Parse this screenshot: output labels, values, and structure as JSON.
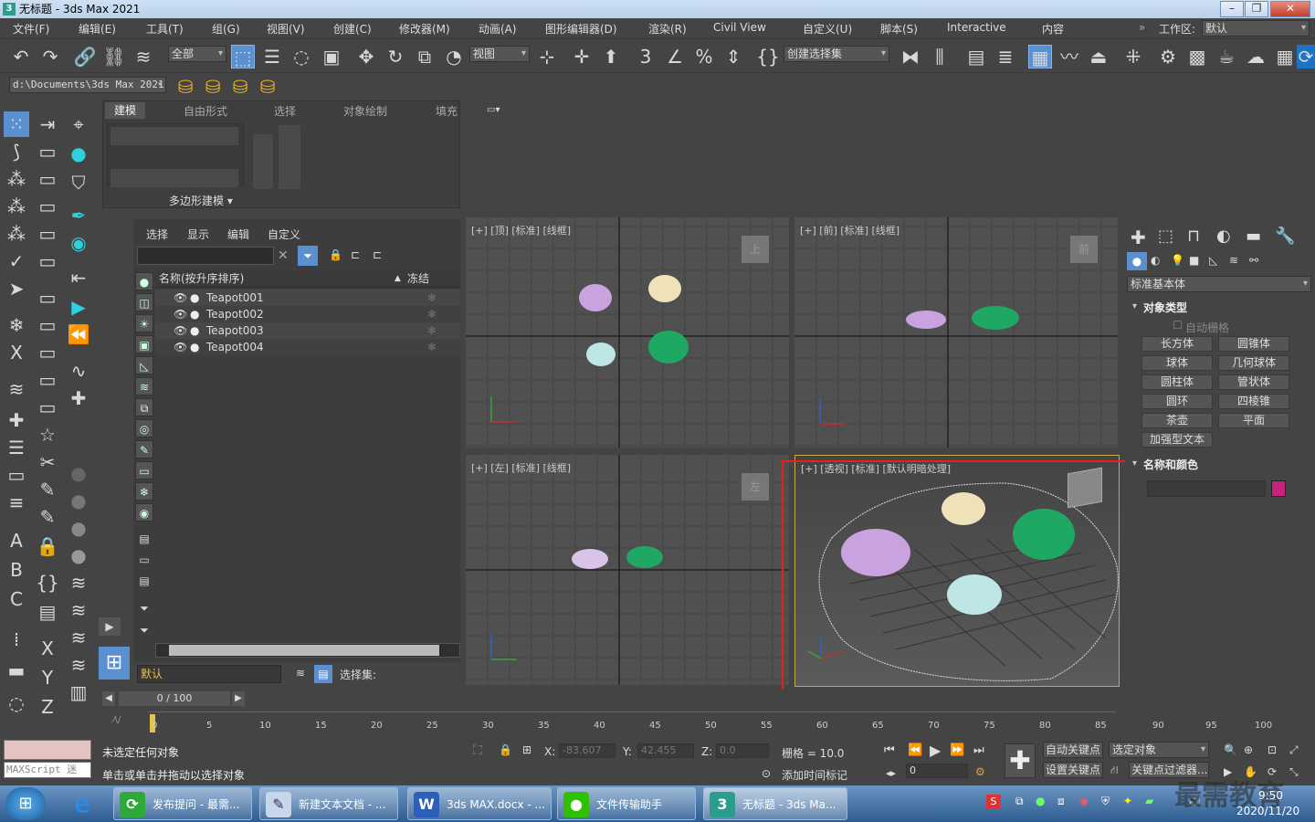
{
  "window": {
    "title": "无标题 - 3ds Max 2021",
    "min": "–",
    "max": "❐",
    "close": "✕"
  },
  "menu": {
    "items": [
      "文件(F)",
      "编辑(E)",
      "工具(T)",
      "组(G)",
      "视图(V)",
      "创建(C)",
      "修改器(M)",
      "动画(A)",
      "图形编辑器(D)",
      "渲染(R)",
      "Civil View",
      "自定义(U)",
      "脚本(S)",
      "Interactive",
      "内容"
    ],
    "workspace_label": "工作区:",
    "workspace_value": "默认"
  },
  "toolbar": {
    "filter": "全部",
    "ref_coord": "视图",
    "selection_set": "创建选择集"
  },
  "toolbar2": {
    "project_path": "d:\\Documents\\3ds Max 2021"
  },
  "ribbon": {
    "tabs": [
      "建模",
      "自由形式",
      "选择",
      "对象绘制",
      "填充"
    ],
    "panel_label": "多边形建模 ▾"
  },
  "scene_explorer": {
    "tabs": [
      "选择",
      "显示",
      "编辑",
      "自定义"
    ],
    "col_name": "名称(按升序排序)",
    "col_freeze": "冻结",
    "objects": [
      "Teapot001",
      "Teapot002",
      "Teapot003",
      "Teapot004"
    ],
    "layer": "默认",
    "selset_label": "选择集:"
  },
  "viewports": {
    "top": "[+] [顶] [标准] [线框]",
    "front": "[+] [前] [标准] [线框]",
    "left": "[+] [左] [标准] [线框]",
    "persp": "[+] [透视] [标准] [默认明暗处理]",
    "cube_top": "上",
    "cube_front": "前",
    "cube_left": "左"
  },
  "command_panel": {
    "category": "标准基本体",
    "rollout_objtype": "对象类型",
    "autogrid": "自动栅格",
    "objects": [
      "长方体",
      "圆锥体",
      "球体",
      "几何球体",
      "圆柱体",
      "管状体",
      "圆环",
      "四棱锥",
      "茶壶",
      "平面",
      "加强型文本"
    ],
    "rollout_namecolor": "名称和颜色",
    "object_color": "#c8237a"
  },
  "timeline": {
    "frame_counter": "0 / 100",
    "ticks": [
      "0",
      "5",
      "10",
      "15",
      "20",
      "25",
      "30",
      "35",
      "40",
      "45",
      "50",
      "55",
      "60",
      "65",
      "70",
      "75",
      "80",
      "85",
      "90",
      "95",
      "100"
    ]
  },
  "status": {
    "maxscript": "MAXScript 迷",
    "line1": "未选定任何对象",
    "line2": "单击或单击并拖动以选择对象",
    "x_label": "X:",
    "x_value": "-83.607",
    "y_label": "Y:",
    "y_value": "42.455",
    "z_label": "Z:",
    "z_value": "0.0",
    "grid": "栅格 = 10.0",
    "add_time_tag": "添加时间标记",
    "auto_key": "自动关键点",
    "selected": "选定对象",
    "set_key": "设置关键点",
    "key_filters": "关键点过滤器...",
    "frame_field": "0"
  },
  "taskbar": {
    "tasks": [
      "发布提问 - 最需...",
      "新建文本文档 - ...",
      "3ds MAX.docx - ...",
      "文件传输助手",
      "无标题 - 3ds Ma..."
    ],
    "time": "9:50",
    "date": "2020/11/20",
    "watermark": "最需教育"
  },
  "colors": {
    "teapot_purple": "#c9a3e0",
    "teapot_cream": "#f0e2b8",
    "teapot_cyan": "#bfe6e6",
    "teapot_green": "#1fa864",
    "highlight_red": "#e8201c",
    "viewport_bg": "#505050"
  }
}
